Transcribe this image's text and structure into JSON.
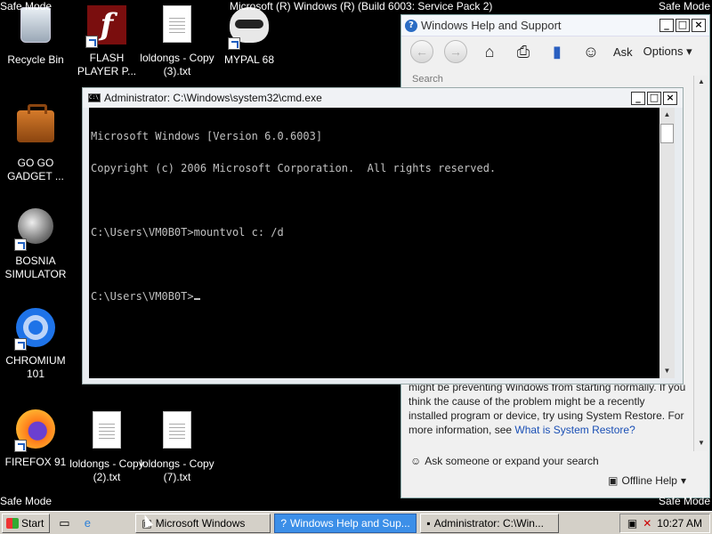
{
  "safe_mode": {
    "tl": "Safe Mode",
    "tr": "Safe Mode",
    "bl": "Safe Mode",
    "br": "Safe Mode"
  },
  "build_text": "Microsoft (R) Windows (R) (Build 6003: Service Pack 2)",
  "desktop_icons": [
    {
      "label": "Recycle Bin"
    },
    {
      "label": "FLASH PLAYER P..."
    },
    {
      "label": "loldongs - Copy (3).txt"
    },
    {
      "label": "MYPAL 68"
    },
    {
      "label": "GO GO GADGET ..."
    },
    {
      "label": "BOSNIA SIMULATOR"
    },
    {
      "label": "CHROMIUM 101"
    },
    {
      "label": "FIREFOX 91"
    },
    {
      "label": "loldongs - Copy (2).txt"
    },
    {
      "label": "loldongs - Copy (7).txt"
    }
  ],
  "help": {
    "title": "Windows Help and Support",
    "toolbar": {
      "ask_label": "Ask",
      "options_label": "Options"
    },
    "search_placeholder": "Search Help",
    "text_before_link": "might be preventing Windows from starting normally. If you think the cause of the problem might be a recently installed program or device, try using System Restore. For more information, see ",
    "link_text": "What is System Restore?",
    "ask_someone": "Ask someone or expand your search",
    "offline_help": "Offline Help"
  },
  "cmd": {
    "title": "Administrator: C:\\Windows\\system32\\cmd.exe",
    "lines": [
      "Microsoft Windows [Version 6.0.6003]",
      "Copyright (c) 2006 Microsoft Corporation.  All rights reserved.",
      "",
      "C:\\Users\\VM0B0T>mountvol c: /d",
      "",
      "C:\\Users\\VM0B0T>"
    ]
  },
  "taskbar": {
    "start_label": "Start",
    "items": [
      {
        "label": "Microsoft Windows"
      },
      {
        "label": "Windows Help and Sup..."
      },
      {
        "label": "Administrator: C:\\Win..."
      }
    ],
    "clock": "10:27 AM"
  }
}
